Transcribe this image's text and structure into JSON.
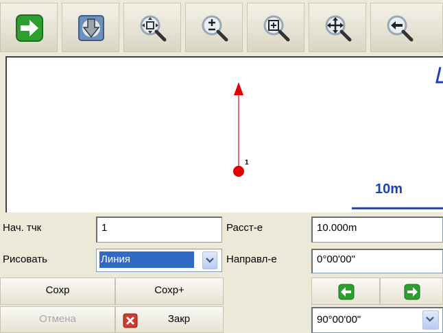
{
  "toolbar": {
    "buttons": [
      {
        "name": "green-arrow-right-icon"
      },
      {
        "name": "download-arrow-icon"
      },
      {
        "name": "zoom-extents-icon"
      },
      {
        "name": "zoom-plus-minus-icon"
      },
      {
        "name": "zoom-window-icon"
      },
      {
        "name": "zoom-pan-icon"
      },
      {
        "name": "zoom-previous-icon"
      }
    ]
  },
  "map": {
    "point_label": "1",
    "scale_label": "10m",
    "colors": {
      "line": "#E04040",
      "point": "#E00000",
      "scale": "#1E3FB5"
    }
  },
  "form": {
    "start_point_label": "Нач. тчк",
    "start_point_value": "1",
    "draw_label": "Рисовать",
    "draw_value": "Линия",
    "distance_label": "Расст-е",
    "distance_value": "10.000m",
    "direction_label": "Направл-е",
    "direction_value": "0°00'00\"",
    "angle_value": "90°00'00\""
  },
  "buttons": {
    "save": "Сохр",
    "save_plus": "Сохр+",
    "cancel": "Отмена",
    "close": "Закр"
  }
}
